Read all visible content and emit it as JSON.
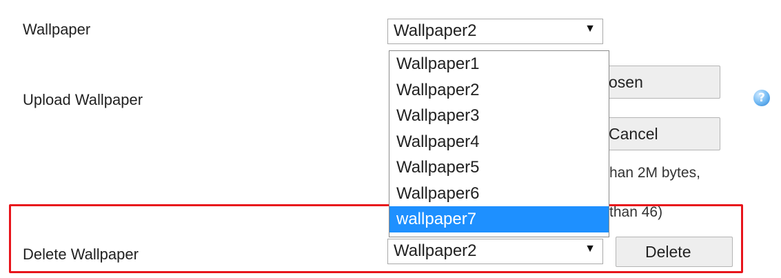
{
  "rows": {
    "wallpaper": {
      "label": "Wallpaper",
      "selected": "Wallpaper2"
    },
    "upload": {
      "label": "Upload Wallpaper",
      "choose_button_partial": "osen",
      "cancel_button": "Cancel",
      "note_line1_partial": "han 2M bytes,",
      "note_line2_partial": "than 46)"
    },
    "delete": {
      "label": "Delete Wallpaper",
      "selected": "Wallpaper2",
      "delete_button": "Delete"
    }
  },
  "dropdown": {
    "options": [
      "Wallpaper1",
      "Wallpaper2",
      "Wallpaper3",
      "Wallpaper4",
      "Wallpaper5",
      "Wallpaper6",
      "wallpaper7"
    ],
    "highlighted_index": 6
  },
  "help_icon": "?",
  "icons": {
    "arrow": "▼",
    "help": "question-help-icon"
  },
  "colors": {
    "highlight_border": "#e8141b",
    "selected_option_bg": "#1e90ff",
    "help_icon": "#3b8fe0"
  }
}
